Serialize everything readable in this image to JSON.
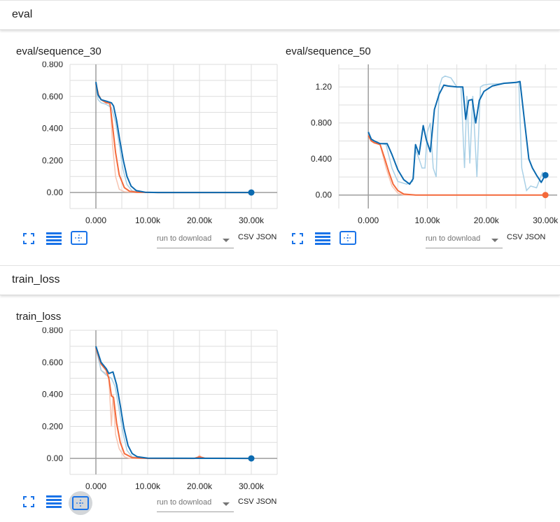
{
  "sections": [
    {
      "title": "eval"
    },
    {
      "title": "train_loss"
    }
  ],
  "download": {
    "placeholder": "run to download",
    "csv": "CSV",
    "json": "JSON"
  },
  "icons": [
    "fit-domain-icon",
    "toggle-log-icon",
    "expand-icon"
  ],
  "colors": {
    "orange": "#f4693a",
    "orange_raw": "#f7c5b2",
    "blue": "#0b6ab0",
    "blue_raw": "#a9d0e6",
    "grid": "#dddddd",
    "axis": "#9e9e9e",
    "icon": "#1a73e8"
  },
  "chart_data": [
    {
      "type": "line",
      "title": "eval/sequence_30",
      "xlim": [
        -5000,
        35000
      ],
      "ylim": [
        -0.1,
        0.8
      ],
      "xticks": [
        0,
        10000,
        20000,
        30000
      ],
      "xtick_labels": [
        "0.000",
        "10.00k",
        "20.00k",
        "30.00k"
      ],
      "yticks": [
        0,
        0.2,
        0.4,
        0.6,
        0.8
      ],
      "ytick_labels": [
        "0.00",
        "0.200",
        "0.400",
        "0.600",
        "0.800"
      ],
      "series": [
        {
          "color": "orange",
          "raw": [
            [
              0,
              0.68
            ],
            [
              500,
              0.6
            ],
            [
              1000,
              0.58
            ],
            [
              2000,
              0.57
            ],
            [
              2800,
              0.54
            ],
            [
              3200,
              0.3
            ],
            [
              3800,
              0.1
            ],
            [
              4500,
              0.02
            ],
            [
              5500,
              0.005
            ],
            [
              8000,
              0
            ],
            [
              30000,
              0
            ]
          ],
          "smooth": [
            [
              0,
              0.68
            ],
            [
              500,
              0.61
            ],
            [
              1000,
              0.58
            ],
            [
              2000,
              0.56
            ],
            [
              2700,
              0.56
            ],
            [
              3200,
              0.42
            ],
            [
              3800,
              0.25
            ],
            [
              4500,
              0.11
            ],
            [
              5500,
              0.03
            ],
            [
              6500,
              0.008
            ],
            [
              8000,
              0.002
            ],
            [
              12000,
              0
            ],
            [
              30000,
              0
            ]
          ]
        },
        {
          "color": "blue",
          "raw": [
            [
              0,
              0.69
            ],
            [
              400,
              0.58
            ],
            [
              1000,
              0.56
            ],
            [
              2000,
              0.55
            ],
            [
              3000,
              0.53
            ],
            [
              3800,
              0.44
            ],
            [
              4500,
              0.3
            ],
            [
              5200,
              0.15
            ],
            [
              6000,
              0.05
            ],
            [
              7000,
              0.01
            ],
            [
              9000,
              0.002
            ],
            [
              30000,
              0
            ]
          ],
          "smooth": [
            [
              0,
              0.69
            ],
            [
              400,
              0.61
            ],
            [
              1000,
              0.58
            ],
            [
              2000,
              0.57
            ],
            [
              3000,
              0.56
            ],
            [
              3400,
              0.54
            ],
            [
              4000,
              0.45
            ],
            [
              4600,
              0.33
            ],
            [
              5300,
              0.2
            ],
            [
              6000,
              0.1
            ],
            [
              6800,
              0.04
            ],
            [
              7800,
              0.012
            ],
            [
              9500,
              0.002
            ],
            [
              12000,
              0
            ],
            [
              30000,
              0
            ]
          ]
        }
      ],
      "endpoint": {
        "x": 30000,
        "y": 0,
        "color": "blue"
      }
    },
    {
      "type": "line",
      "title": "eval/sequence_50",
      "xlim": [
        -5000,
        32000
      ],
      "ylim": [
        -0.15,
        1.45
      ],
      "xticks": [
        0,
        10000,
        20000,
        30000
      ],
      "xtick_labels": [
        "0.000",
        "10.00k",
        "20.00k",
        "30.00k"
      ],
      "yticks": [
        0,
        0.4,
        0.8,
        1.2
      ],
      "ytick_labels": [
        "0.00",
        "0.400",
        "0.800",
        "1.20"
      ],
      "series": [
        {
          "color": "orange",
          "raw": [
            [
              0,
              0.66
            ],
            [
              500,
              0.6
            ],
            [
              1000,
              0.58
            ],
            [
              2000,
              0.56
            ],
            [
              3000,
              0.3
            ],
            [
              4000,
              0.1
            ],
            [
              5000,
              0.02
            ],
            [
              6000,
              0
            ],
            [
              30000,
              0
            ]
          ],
          "smooth": [
            [
              0,
              0.66
            ],
            [
              500,
              0.6
            ],
            [
              1000,
              0.58
            ],
            [
              2000,
              0.56
            ],
            [
              2800,
              0.4
            ],
            [
              3500,
              0.25
            ],
            [
              4200,
              0.12
            ],
            [
              5000,
              0.05
            ],
            [
              6000,
              0.01
            ],
            [
              8000,
              0
            ],
            [
              30000,
              0
            ]
          ]
        },
        {
          "color": "blue",
          "raw": [
            [
              0,
              0.7
            ],
            [
              600,
              0.6
            ],
            [
              1500,
              0.58
            ],
            [
              3000,
              0.56
            ],
            [
              4000,
              0.3
            ],
            [
              5000,
              0.15
            ],
            [
              6500,
              0.12
            ],
            [
              7500,
              0.15
            ],
            [
              8000,
              0.5
            ],
            [
              8600,
              0.4
            ],
            [
              9100,
              0.3
            ],
            [
              9600,
              0.3
            ],
            [
              10000,
              0.7
            ],
            [
              10500,
              0.8
            ],
            [
              11000,
              0.3
            ],
            [
              11500,
              0.2
            ],
            [
              12000,
              1.2
            ],
            [
              12500,
              1.3
            ],
            [
              13000,
              1.32
            ],
            [
              14000,
              1.3
            ],
            [
              15000,
              1.2
            ],
            [
              15700,
              1.2
            ],
            [
              16300,
              0.3
            ],
            [
              16700,
              1.1
            ],
            [
              17200,
              0.35
            ],
            [
              17700,
              1.1
            ],
            [
              18400,
              0.2
            ],
            [
              19000,
              1.2
            ],
            [
              19500,
              1.22
            ],
            [
              20500,
              1.23
            ],
            [
              24000,
              1.24
            ],
            [
              25500,
              1.25
            ],
            [
              26000,
              0.3
            ],
            [
              26800,
              0.05
            ],
            [
              27500,
              0.1
            ],
            [
              28500,
              0.08
            ],
            [
              29500,
              0.25
            ],
            [
              30000,
              0.22
            ]
          ],
          "smooth": [
            [
              0,
              0.7
            ],
            [
              500,
              0.62
            ],
            [
              1000,
              0.6
            ],
            [
              2000,
              0.57
            ],
            [
              3200,
              0.57
            ],
            [
              4000,
              0.45
            ],
            [
              5000,
              0.28
            ],
            [
              6000,
              0.17
            ],
            [
              7000,
              0.12
            ],
            [
              7600,
              0.18
            ],
            [
              8000,
              0.56
            ],
            [
              8600,
              0.45
            ],
            [
              9300,
              0.77
            ],
            [
              9800,
              0.62
            ],
            [
              10500,
              0.48
            ],
            [
              11200,
              0.95
            ],
            [
              12000,
              1.12
            ],
            [
              12800,
              1.22
            ],
            [
              13500,
              1.21
            ],
            [
              15000,
              1.2
            ],
            [
              16000,
              1.2
            ],
            [
              16500,
              0.84
            ],
            [
              17000,
              1.05
            ],
            [
              17600,
              1.06
            ],
            [
              18200,
              0.8
            ],
            [
              18800,
              1.05
            ],
            [
              19600,
              1.15
            ],
            [
              21000,
              1.21
            ],
            [
              23000,
              1.24
            ],
            [
              25000,
              1.25
            ],
            [
              25700,
              1.26
            ],
            [
              26500,
              0.8
            ],
            [
              27200,
              0.4
            ],
            [
              27800,
              0.3
            ],
            [
              28500,
              0.22
            ],
            [
              29300,
              0.14
            ],
            [
              29800,
              0.2
            ],
            [
              30000,
              0.22
            ]
          ]
        }
      ],
      "endpoint": {
        "x": 30000,
        "y": 0.22,
        "color": "blue"
      },
      "endpoint2": {
        "x": 30000,
        "y": 0,
        "color": "orange"
      }
    },
    {
      "type": "line",
      "title": "train_loss",
      "xlim": [
        -5000,
        35000
      ],
      "ylim": [
        -0.1,
        0.8
      ],
      "xticks": [
        0,
        10000,
        20000,
        30000
      ],
      "xtick_labels": [
        "0.000",
        "10.00k",
        "20.00k",
        "30.00k"
      ],
      "yticks": [
        0,
        0.2,
        0.4,
        0.6,
        0.8
      ],
      "ytick_labels": [
        "0.00",
        "0.200",
        "0.400",
        "0.600",
        "0.800"
      ],
      "series": [
        {
          "color": "orange",
          "raw": [
            [
              0,
              0.69
            ],
            [
              500,
              0.62
            ],
            [
              1000,
              0.55
            ],
            [
              2000,
              0.53
            ],
            [
              2500,
              0.5
            ],
            [
              3000,
              0.2
            ],
            [
              3300,
              0.4
            ],
            [
              3800,
              0.15
            ],
            [
              4500,
              0.06
            ],
            [
              5500,
              0.01
            ],
            [
              6500,
              0
            ],
            [
              19500,
              0
            ],
            [
              20000,
              0.02
            ],
            [
              20500,
              0
            ],
            [
              30000,
              0
            ]
          ],
          "smooth": [
            [
              0,
              0.69
            ],
            [
              500,
              0.64
            ],
            [
              1000,
              0.59
            ],
            [
              2000,
              0.55
            ],
            [
              2500,
              0.5
            ],
            [
              3000,
              0.39
            ],
            [
              3400,
              0.38
            ],
            [
              4000,
              0.22
            ],
            [
              4700,
              0.1
            ],
            [
              5500,
              0.03
            ],
            [
              7000,
              0.005
            ],
            [
              10000,
              0
            ],
            [
              19000,
              0
            ],
            [
              20000,
              0.01
            ],
            [
              21000,
              0.002
            ],
            [
              30000,
              0
            ]
          ]
        },
        {
          "color": "blue",
          "raw": [
            [
              0,
              0.69
            ],
            [
              500,
              0.62
            ],
            [
              1000,
              0.55
            ],
            [
              2000,
              0.52
            ],
            [
              3000,
              0.5
            ],
            [
              3700,
              0.45
            ],
            [
              4500,
              0.3
            ],
            [
              5300,
              0.15
            ],
            [
              6000,
              0.05
            ],
            [
              7000,
              0.01
            ],
            [
              9000,
              0
            ],
            [
              30000,
              0
            ]
          ],
          "smooth": [
            [
              0,
              0.7
            ],
            [
              500,
              0.65
            ],
            [
              1000,
              0.6
            ],
            [
              2000,
              0.56
            ],
            [
              2500,
              0.53
            ],
            [
              3300,
              0.54
            ],
            [
              4000,
              0.46
            ],
            [
              4700,
              0.33
            ],
            [
              5400,
              0.19
            ],
            [
              6200,
              0.08
            ],
            [
              7000,
              0.03
            ],
            [
              8000,
              0.01
            ],
            [
              10000,
              0.002
            ],
            [
              30000,
              0
            ]
          ]
        }
      ],
      "endpoint": {
        "x": 30000,
        "y": 0,
        "color": "blue"
      }
    }
  ]
}
